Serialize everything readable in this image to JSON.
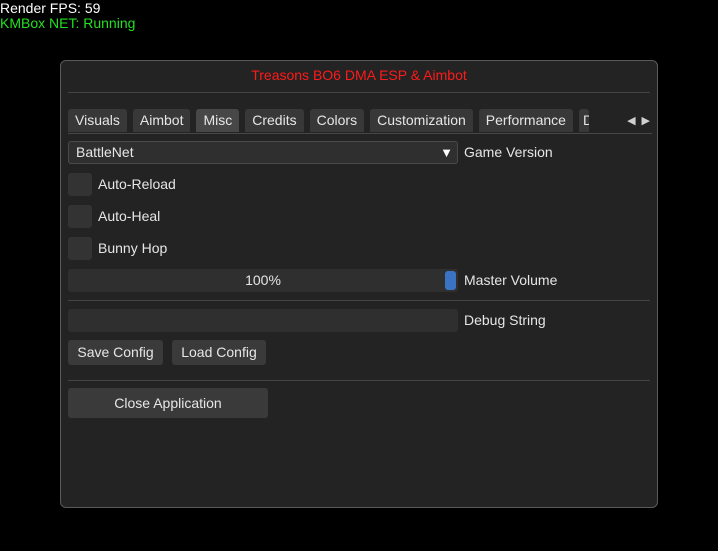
{
  "overlay": {
    "fps_text": "Render FPS: 59",
    "kmbox_text": "KMBox NET: Running",
    "kmbox_color": "#22e022"
  },
  "window": {
    "title": "Treasons BO6 DMA ESP & Aimbot",
    "title_color": "#ff1a1a"
  },
  "tabs": [
    {
      "label": "Visuals"
    },
    {
      "label": "Aimbot"
    },
    {
      "label": "Misc",
      "active": true
    },
    {
      "label": "Credits"
    },
    {
      "label": "Colors"
    },
    {
      "label": "Customization"
    },
    {
      "label": "Performance"
    },
    {
      "label": "D"
    }
  ],
  "tab_scroll": {
    "left_icon": "triangle-left-icon",
    "right_icon": "triangle-right-icon"
  },
  "misc": {
    "game_version": {
      "value": "BattleNet",
      "label": "Game Version",
      "arrow_icon": "triangle-down-icon"
    },
    "checkboxes": [
      {
        "label": "Auto-Reload",
        "checked": false
      },
      {
        "label": "Auto-Heal",
        "checked": false
      },
      {
        "label": "Bunny Hop",
        "checked": false
      }
    ],
    "master_volume": {
      "value_text": "100%",
      "value": 1.0,
      "label": "Master Volume",
      "grab_color": "#3a73c4"
    },
    "debug_string": {
      "value": "",
      "label": "Debug String"
    },
    "save_config_label": "Save Config",
    "load_config_label": "Load Config",
    "close_application_label": "Close Application"
  }
}
